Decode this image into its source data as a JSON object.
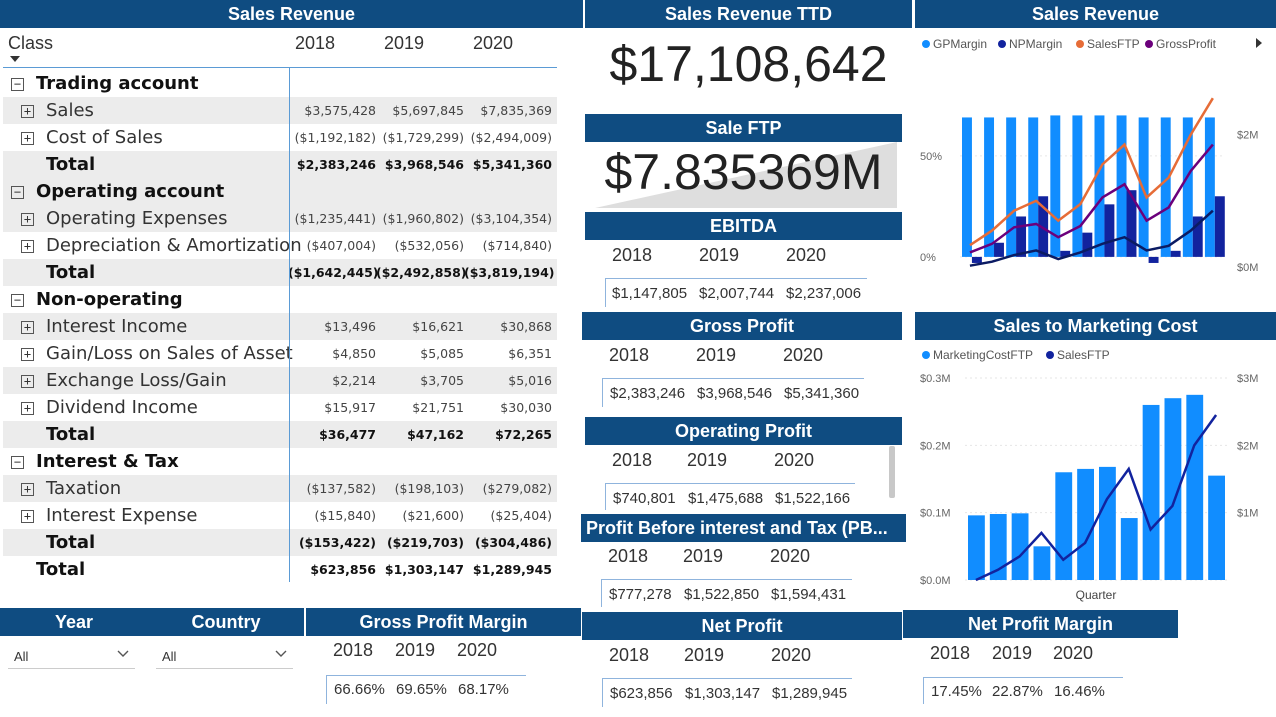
{
  "matrix": {
    "title": "Sales Revenue",
    "class_header": "Class",
    "years": [
      "2018",
      "2019",
      "2020"
    ],
    "rows": [
      {
        "type": "group",
        "label": "Trading account"
      },
      {
        "type": "item",
        "label": "Sales",
        "values": [
          "$3,575,428",
          "$5,697,845",
          "$7,835,369"
        ]
      },
      {
        "type": "item",
        "label": "Cost of Sales",
        "values": [
          "($1,192,182)",
          "($1,729,299)",
          "($2,494,009)"
        ]
      },
      {
        "type": "total",
        "label": "Total",
        "values": [
          "$2,383,246",
          "$3,968,546",
          "$5,341,360"
        ]
      },
      {
        "type": "group",
        "label": "Operating account"
      },
      {
        "type": "item",
        "label": "Operating Expenses",
        "values": [
          "($1,235,441)",
          "($1,960,802)",
          "($3,104,354)"
        ]
      },
      {
        "type": "item",
        "label": "Depreciation & Amortization",
        "values": [
          "($407,004)",
          "($532,056)",
          "($714,840)"
        ]
      },
      {
        "type": "total",
        "label": "Total",
        "values": [
          "($1,642,445)",
          "($2,492,858)",
          "($3,819,194)"
        ]
      },
      {
        "type": "group",
        "label": "Non-operating"
      },
      {
        "type": "item",
        "label": "Interest Income",
        "values": [
          "$13,496",
          "$16,621",
          "$30,868"
        ]
      },
      {
        "type": "item",
        "label": "Gain/Loss on Sales of Asset",
        "values": [
          "$4,850",
          "$5,085",
          "$6,351"
        ]
      },
      {
        "type": "item",
        "label": "Exchange Loss/Gain",
        "values": [
          "$2,214",
          "$3,705",
          "$5,016"
        ]
      },
      {
        "type": "item",
        "label": "Dividend Income",
        "values": [
          "$15,917",
          "$21,751",
          "$30,030"
        ]
      },
      {
        "type": "total",
        "label": "Total",
        "values": [
          "$36,477",
          "$47,162",
          "$72,265"
        ]
      },
      {
        "type": "group",
        "label": "Interest & Tax"
      },
      {
        "type": "item",
        "label": "Taxation",
        "values": [
          "($137,582)",
          "($198,103)",
          "($279,082)"
        ]
      },
      {
        "type": "item",
        "label": "Interest Expense",
        "values": [
          "($15,840)",
          "($21,600)",
          "($25,404)"
        ]
      },
      {
        "type": "total",
        "label": "Total",
        "values": [
          "($153,422)",
          "($219,703)",
          "($304,486)"
        ]
      },
      {
        "type": "grand",
        "label": "Total",
        "values": [
          "$623,856",
          "$1,303,147",
          "$1,289,945"
        ]
      }
    ]
  },
  "slicers": {
    "year": {
      "title": "Year",
      "value": "All"
    },
    "country": {
      "title": "Country",
      "value": "All"
    }
  },
  "gpm": {
    "title": "Gross Profit Margin",
    "years": [
      "2018",
      "2019",
      "2020"
    ],
    "values": [
      "66.66%",
      "69.65%",
      "68.17%"
    ]
  },
  "ttd": {
    "title": "Sales Revenue TTD",
    "value": "$17,108,642"
  },
  "ftp": {
    "title": "Sale FTP",
    "value": "$7.835369M"
  },
  "ebitda": {
    "title": "EBITDA",
    "years": [
      "2018",
      "2019",
      "2020"
    ],
    "values": [
      "$1,147,805",
      "$2,007,744",
      "$2,237,006"
    ]
  },
  "gross_profit": {
    "title": "Gross Profit",
    "years": [
      "2018",
      "2019",
      "2020"
    ],
    "values": [
      "$2,383,246",
      "$3,968,546",
      "$5,341,360"
    ]
  },
  "operating_profit": {
    "title": "Operating Profit",
    "years": [
      "2018",
      "2019",
      "2020"
    ],
    "values": [
      "$740,801",
      "$1,475,688",
      "$1,522,166"
    ]
  },
  "pbit": {
    "title": "Profit Before interest and Tax (PB...",
    "years": [
      "2018",
      "2019",
      "2020"
    ],
    "values": [
      "$777,278",
      "$1,522,850",
      "$1,594,431"
    ]
  },
  "net_profit": {
    "title": "Net Profit",
    "years": [
      "2018",
      "2019",
      "2020"
    ],
    "values": [
      "$623,856",
      "$1,303,147",
      "$1,289,945"
    ]
  },
  "npm": {
    "title": "Net Profit Margin",
    "years": [
      "2018",
      "2019",
      "2020"
    ],
    "values": [
      "17.45%",
      "22.87%",
      "16.46%"
    ]
  },
  "colors": {
    "header": "#0f4c81",
    "gp": "#118dff",
    "np": "#12239e",
    "salesftp": "#e66c37",
    "grossprofit": "#6b007b"
  },
  "chart_data": [
    {
      "type": "bar",
      "title": "Sales Revenue",
      "legend": [
        "GPMargin",
        "NPMargin",
        "SalesFTP",
        "GrossProfit"
      ],
      "left_ticks": [
        "50%",
        "0%"
      ],
      "right_ticks": [
        "$2M",
        "$0M"
      ],
      "series": [
        {
          "name": "GPMargin",
          "kind": "bar",
          "values": [
            0.69,
            0.69,
            0.69,
            0.69,
            0.7,
            0.7,
            0.7,
            0.7,
            0.69,
            0.69,
            0.69,
            0.69
          ]
        },
        {
          "name": "NPMargin",
          "kind": "bar",
          "values": [
            -0.03,
            0.07,
            0.2,
            0.3,
            0.03,
            0.12,
            0.26,
            0.33,
            -0.03,
            0.03,
            0.2,
            0.3
          ]
        },
        {
          "name": "SalesFTP",
          "kind": "line",
          "values": [
            0.33,
            0.55,
            0.85,
            1.0,
            0.7,
            0.95,
            1.55,
            1.85,
            1.05,
            1.35,
            2.0,
            2.55
          ]
        },
        {
          "name": "GrossProfit",
          "kind": "line",
          "values": [
            0.22,
            0.35,
            0.6,
            0.65,
            0.45,
            0.62,
            1.05,
            1.25,
            0.7,
            0.9,
            1.45,
            1.85
          ]
        },
        {
          "name": "NPMargin-line",
          "kind": "line",
          "values": [
            0.02,
            0.08,
            0.18,
            0.25,
            0.12,
            0.22,
            0.35,
            0.45,
            0.25,
            0.32,
            0.55,
            0.85
          ]
        }
      ],
      "ylim_left": [
        -0.05,
        0.9
      ],
      "ylim_right": [
        0,
        2.9
      ]
    },
    {
      "type": "bar",
      "title": "Sales to Marketing Cost",
      "legend": [
        "MarketingCostFTP",
        "SalesFTP"
      ],
      "xlabel": "Quarter",
      "left_ticks": [
        "$0.3M",
        "$0.2M",
        "$0.1M",
        "$0.0M"
      ],
      "right_ticks": [
        "$3M",
        "$2M",
        "$1M"
      ],
      "series": [
        {
          "name": "MarketingCostFTP",
          "kind": "bar",
          "values": [
            0.096,
            0.098,
            0.099,
            0.05,
            0.16,
            0.165,
            0.168,
            0.092,
            0.26,
            0.27,
            0.275,
            0.155
          ]
        },
        {
          "name": "SalesFTP",
          "kind": "line",
          "values": [
            0.0,
            0.15,
            0.35,
            0.7,
            0.3,
            0.55,
            1.2,
            1.65,
            0.75,
            1.1,
            2.0,
            2.45
          ]
        }
      ],
      "ylim_left": [
        0,
        0.3
      ],
      "ylim_right": [
        0,
        3
      ]
    }
  ]
}
